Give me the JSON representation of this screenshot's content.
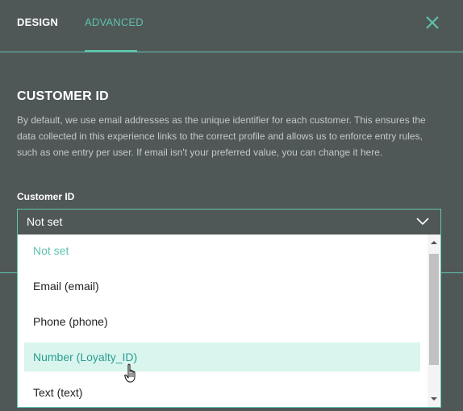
{
  "tabs": {
    "design": "DESIGN",
    "advanced": "ADVANCED",
    "active": "ADVANCED"
  },
  "section": {
    "title": "CUSTOMER ID",
    "description": "By default, we use email addresses as the unique identifier for each customer. This ensures the data collected in this experience links to the correct profile and allows us to enforce entry rules, such as one entry per user. If email isn't your preferred value, you can change it here."
  },
  "field": {
    "label": "Customer ID",
    "selected": "Not set"
  },
  "dropdown": {
    "options": [
      {
        "label": "Not set",
        "state": "placeholder"
      },
      {
        "label": "Email (email)",
        "state": "normal"
      },
      {
        "label": "Phone (phone)",
        "state": "normal"
      },
      {
        "label": "Number (Loyalty_ID)",
        "state": "hovered"
      },
      {
        "label": "Text (text)",
        "state": "normal"
      }
    ]
  },
  "icons": {
    "close": "close-icon",
    "chevron": "chevron-down-icon",
    "scroll_up": "scroll-up-arrow-icon",
    "scroll_down": "scroll-down-arrow-icon",
    "cursor": "hand-pointer-icon"
  },
  "colors": {
    "background": "#505857",
    "accent": "#5fc2ae",
    "hover_bg": "#d9f5ee",
    "hover_text": "#2a9d8f",
    "option_text": "#222222"
  }
}
